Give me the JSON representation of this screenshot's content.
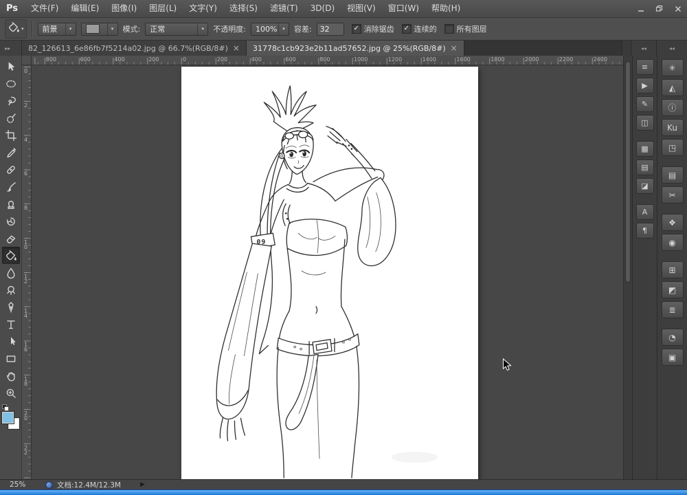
{
  "window": {
    "logo": "Ps",
    "menus": [
      {
        "label": "文件(F)"
      },
      {
        "label": "编辑(E)"
      },
      {
        "label": "图像(I)"
      },
      {
        "label": "图层(L)"
      },
      {
        "label": "文字(Y)"
      },
      {
        "label": "选择(S)"
      },
      {
        "label": "滤镜(T)"
      },
      {
        "label": "3D(D)"
      },
      {
        "label": "视图(V)"
      },
      {
        "label": "窗口(W)"
      },
      {
        "label": "帮助(H)"
      }
    ]
  },
  "options_bar": {
    "fill_source_value": "前景",
    "mode_label": "模式:",
    "mode_value": "正常",
    "opacity_label": "不透明度:",
    "opacity_value": "100%",
    "tolerance_label": "容差:",
    "tolerance_value": "32",
    "checkboxes": [
      {
        "label": "消除锯齿",
        "checked": true
      },
      {
        "label": "连续的",
        "checked": true
      },
      {
        "label": "所有图层",
        "checked": false
      }
    ]
  },
  "tabs": [
    {
      "title": "82_126613_6e86fb7f5214a02.jpg @ 66.7%(RGB/8#)",
      "close_glyph": "×",
      "active": false
    },
    {
      "title": "31778c1cb923e2b11ad57652.jpg @ 25%(RGB/8#)",
      "close_glyph": "×",
      "active": true
    }
  ],
  "toolbar": {
    "collapse_glyph": "▸▸",
    "foreground_color": "#7fc0e4",
    "background_color": "#ffffff",
    "tools": [
      {
        "name": "move-tool",
        "active": false
      },
      {
        "name": "elliptical-marquee-tool",
        "active": false
      },
      {
        "name": "lasso-tool",
        "active": false
      },
      {
        "name": "quick-selection-tool",
        "active": false
      },
      {
        "name": "crop-tool",
        "active": false
      },
      {
        "name": "eyedropper-tool",
        "active": false
      },
      {
        "name": "spot-healing-brush-tool",
        "active": false
      },
      {
        "name": "brush-tool",
        "active": false
      },
      {
        "name": "clone-stamp-tool",
        "active": false
      },
      {
        "name": "history-brush-tool",
        "active": false
      },
      {
        "name": "eraser-tool",
        "active": false
      },
      {
        "name": "paint-bucket-tool",
        "active": true
      },
      {
        "name": "blur-tool",
        "active": false
      },
      {
        "name": "dodge-tool",
        "active": false
      },
      {
        "name": "pen-tool",
        "active": false
      },
      {
        "name": "type-tool",
        "active": false
      },
      {
        "name": "path-selection-tool",
        "active": false
      },
      {
        "name": "rectangle-tool",
        "active": false
      },
      {
        "name": "hand-tool",
        "active": false
      },
      {
        "name": "zoom-tool",
        "active": false
      }
    ]
  },
  "rulers": {
    "top_labels": [
      "800",
      "600",
      "400",
      "200",
      "0",
      "200",
      "400",
      "600",
      "800",
      "1000",
      "1200",
      "1400",
      "1600",
      "1800",
      "2000",
      "2200",
      "2400"
    ],
    "left_labels": [
      "0",
      "2",
      "4",
      "6",
      "8",
      "10",
      "12",
      "14",
      "16",
      "18",
      "20",
      "22",
      "24"
    ]
  },
  "docks": {
    "collapse_glyph": "◂◂",
    "column1": [
      {
        "name": "timeline-panel-icon",
        "glyph": "≡",
        "group_break": false
      },
      {
        "name": "actions-panel-icon",
        "glyph": "▶",
        "group_break": false
      },
      {
        "name": "tool-presets-panel-icon",
        "glyph": "✎",
        "group_break": false
      },
      {
        "name": "clone-source-panel-icon",
        "glyph": "◫",
        "group_break": false
      },
      {
        "name": "styles-panel-icon",
        "glyph": "▦",
        "group_break": true
      },
      {
        "name": "layer-comps-panel-icon",
        "glyph": "▤",
        "group_break": false
      },
      {
        "name": "histogram-panel-icon",
        "glyph": "◪",
        "group_break": false
      },
      {
        "name": "character-panel-icon",
        "glyph": "A",
        "group_break": true
      },
      {
        "name": "paragraph-panel-icon",
        "glyph": "¶",
        "group_break": false
      }
    ],
    "column2": [
      {
        "name": "brush-panel-icon",
        "glyph": "✳",
        "group_break": false
      },
      {
        "name": "navigator-panel-icon",
        "glyph": "◭",
        "group_break": false
      },
      {
        "name": "info-panel-icon",
        "glyph": "ⓘ",
        "group_break": false
      },
      {
        "name": "kuler-panel-icon",
        "glyph": "Ku",
        "group_break": false
      },
      {
        "name": "properties-panel-icon",
        "glyph": "◳",
        "group_break": false
      },
      {
        "name": "notes-panel-icon",
        "glyph": "▤",
        "group_break": true
      },
      {
        "name": "measurement-log-panel-icon",
        "glyph": "✂",
        "group_break": false
      },
      {
        "name": "3d-panel-icon",
        "glyph": "❖",
        "group_break": true
      },
      {
        "name": "animation-panel-icon",
        "glyph": "◉",
        "group_break": false
      },
      {
        "name": "swatches-panel-icon",
        "glyph": "⊞",
        "group_break": true
      },
      {
        "name": "adjustments-panel-icon",
        "glyph": "◩",
        "group_break": false
      },
      {
        "name": "layers-panel-icon",
        "glyph": "≣",
        "group_break": false
      },
      {
        "name": "channels-panel-icon",
        "glyph": "◔",
        "group_break": true
      },
      {
        "name": "paths-panel-icon",
        "glyph": "▣",
        "group_break": false
      }
    ]
  },
  "status_bar": {
    "zoom": "25%",
    "doc_label": "文档:12.4M/12.3M",
    "flyout_glyph": "▶"
  },
  "artwork": {
    "armband_text": "09"
  },
  "icons": {
    "check_glyph": "✓",
    "combo_arrow_glyph": "▾"
  },
  "colors": {
    "accent_blue": "#2e9df7",
    "foreground_swatch": "#7fc0e4",
    "canvas_surround": "#474747"
  }
}
